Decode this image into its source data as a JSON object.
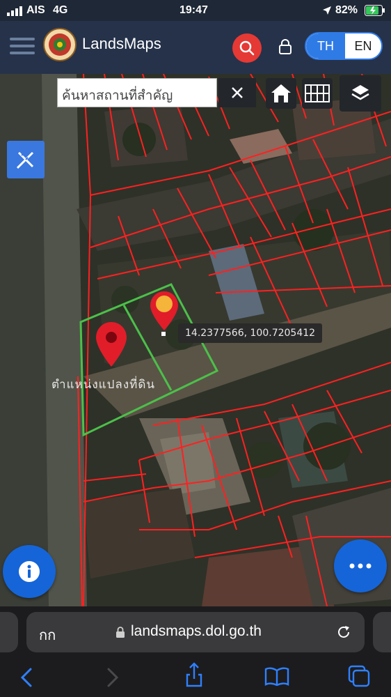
{
  "status_bar": {
    "carrier": "AIS",
    "network": "4G",
    "time": "19:47",
    "battery": "82%"
  },
  "header": {
    "app_name": "LandsMaps",
    "lang_th": "TH",
    "lang_en": "EN"
  },
  "map": {
    "search_placeholder": "ค้นหาสถานที่สำคัญ",
    "coordinates": "14.2377566, 100.7205412",
    "parcel_label": "ตำแหน่งแปลงที่ดิน"
  },
  "browser": {
    "aa_label": "กก",
    "url": "landsmaps.dol.go.th"
  },
  "colors": {
    "parcel_lines": "#ff2020",
    "selected_parcel": "#4cc04a",
    "accent_blue": "#1565d8",
    "search_red": "#e53935"
  }
}
